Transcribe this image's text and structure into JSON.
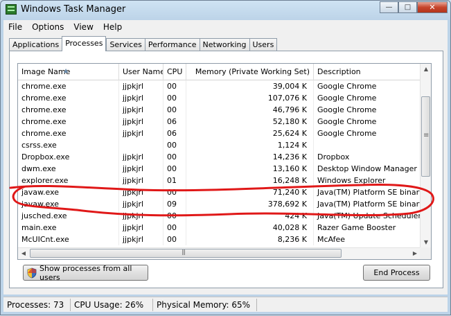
{
  "window": {
    "title": "Windows Task Manager",
    "minimize_label": "—",
    "maximize_label": "□",
    "close_label": "✕"
  },
  "menu": [
    "File",
    "Options",
    "View",
    "Help"
  ],
  "tabs": [
    "Applications",
    "Processes",
    "Services",
    "Performance",
    "Networking",
    "Users"
  ],
  "active_tab": "Processes",
  "columns": {
    "name": "Image Name",
    "user": "User Name",
    "cpu": "CPU",
    "memory": "Memory (Private Working Set)",
    "description": "Description"
  },
  "processes": [
    {
      "name": "chrome.exe",
      "user": "jjpkjrl",
      "cpu": "00",
      "memory": "39,004 K",
      "description": "Google Chrome"
    },
    {
      "name": "chrome.exe",
      "user": "jjpkjrl",
      "cpu": "00",
      "memory": "107,076 K",
      "description": "Google Chrome"
    },
    {
      "name": "chrome.exe",
      "user": "jjpkjrl",
      "cpu": "00",
      "memory": "46,796 K",
      "description": "Google Chrome"
    },
    {
      "name": "chrome.exe",
      "user": "jjpkjrl",
      "cpu": "06",
      "memory": "52,180 K",
      "description": "Google Chrome"
    },
    {
      "name": "chrome.exe",
      "user": "jjpkjrl",
      "cpu": "06",
      "memory": "25,624 K",
      "description": "Google Chrome"
    },
    {
      "name": "csrss.exe",
      "user": "",
      "cpu": "00",
      "memory": "1,124 K",
      "description": ""
    },
    {
      "name": "Dropbox.exe",
      "user": "jjpkjrl",
      "cpu": "00",
      "memory": "14,236 K",
      "description": "Dropbox"
    },
    {
      "name": "dwm.exe",
      "user": "jjpkjrl",
      "cpu": "00",
      "memory": "13,160 K",
      "description": "Desktop Window Manager"
    },
    {
      "name": "explorer.exe",
      "user": "jjpkjrl",
      "cpu": "01",
      "memory": "16,248 K",
      "description": "Windows Explorer"
    },
    {
      "name": "javaw.exe",
      "user": "jjpkjrl",
      "cpu": "00",
      "memory": "71,240 K",
      "description": "Java(TM) Platform SE binary"
    },
    {
      "name": "javaw.exe",
      "user": "jjpkjrl",
      "cpu": "09",
      "memory": "378,692 K",
      "description": "Java(TM) Platform SE binary"
    },
    {
      "name": "jusched.exe",
      "user": "jjpkjrl",
      "cpu": "00",
      "memory": "424 K",
      "description": "Java(TM) Update Scheduler"
    },
    {
      "name": "main.exe",
      "user": "jjpkjrl",
      "cpu": "00",
      "memory": "40,028 K",
      "description": "Razer Game Booster"
    },
    {
      "name": "McUICnt.exe",
      "user": "jjpkjrl",
      "cpu": "00",
      "memory": "8,236 K",
      "description": "McAfee"
    }
  ],
  "buttons": {
    "show_all": "Show processes from all users",
    "end_process": "End Process"
  },
  "status": {
    "processes": "Processes: 73",
    "cpu": "CPU Usage: 26%",
    "memory": "Physical Memory: 65%"
  },
  "colors": {
    "annotation": "#e01818",
    "title_bar": "#bcd3e8",
    "close_button": "#c7452c"
  },
  "icons": [
    "task-manager-icon",
    "uac-shield-icon"
  ]
}
